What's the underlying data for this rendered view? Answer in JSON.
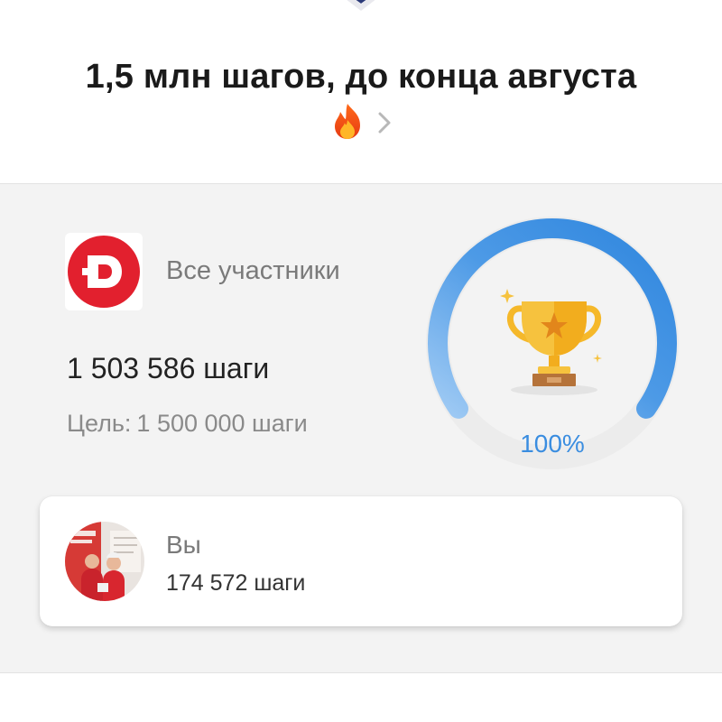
{
  "challenge": {
    "title": "1,5 млн шагов, до конца августа",
    "emoji": "🔥",
    "emoji_name": "fire-icon",
    "chevron_icon": "chevron-right-icon"
  },
  "team": {
    "logo_letter": "D",
    "logo_color": "#e2202e",
    "label": "Все участники",
    "steps_text": "1 503 586 шаги",
    "goal_label": "Цель:",
    "goal_value": "1 500 000 шаги"
  },
  "progress": {
    "percent_text": "100%",
    "value": 1.0,
    "accent_color": "#3a8de0",
    "icon": "trophy-icon"
  },
  "you": {
    "name": "Вы",
    "steps_text": "174 572 шаги"
  }
}
